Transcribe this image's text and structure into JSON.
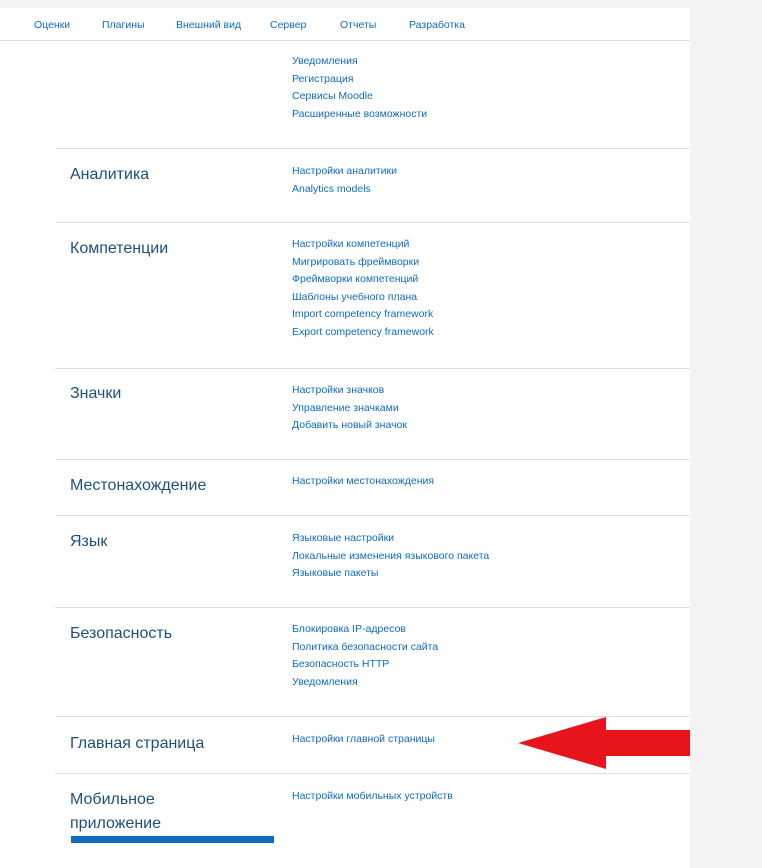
{
  "nav": {
    "tabs": [
      "Оценки",
      "Плагины",
      "Внешний вид",
      "Сервер",
      "Отчеты",
      "Разработка"
    ]
  },
  "top_links": [
    "Уведомления",
    "Регистрация",
    "Сервисы Moodle",
    "Расширенные возможности"
  ],
  "sections": [
    {
      "title": "Аналитика",
      "links": [
        "Настройки аналитики",
        "Analytics models"
      ]
    },
    {
      "title": "Компетенции",
      "links": [
        "Настройки компетенций",
        "Мигрировать фреймворки",
        "Фреймворки компетенций",
        "Шаблоны учебного плана",
        "Import competency framework",
        "Export competency framework"
      ]
    },
    {
      "title": "Значки",
      "links": [
        "Настройки значков",
        "Управление значками",
        "Добавить новый значок"
      ]
    },
    {
      "title": "Местонахождение",
      "links": [
        "Настройки местонахождения"
      ]
    },
    {
      "title": "Язык",
      "links": [
        "Языковые настройки",
        "Локальные изменения языкового пакета",
        "Языковые пакеты"
      ]
    },
    {
      "title": "Безопасность",
      "links": [
        "Блокировка IP-адресов",
        "Политика безопасности сайта",
        "Безопасность HTTP",
        "Уведомления"
      ]
    },
    {
      "title": "Главная страница",
      "links": [
        "Настройки главной страницы"
      ]
    },
    {
      "title": "Мобильное приложение",
      "links": [
        "Настройки мобильных устройств"
      ]
    }
  ],
  "colors": {
    "link": "#0f6cbf",
    "heading": "#1f4f7f",
    "arrow": "#e8141c"
  }
}
